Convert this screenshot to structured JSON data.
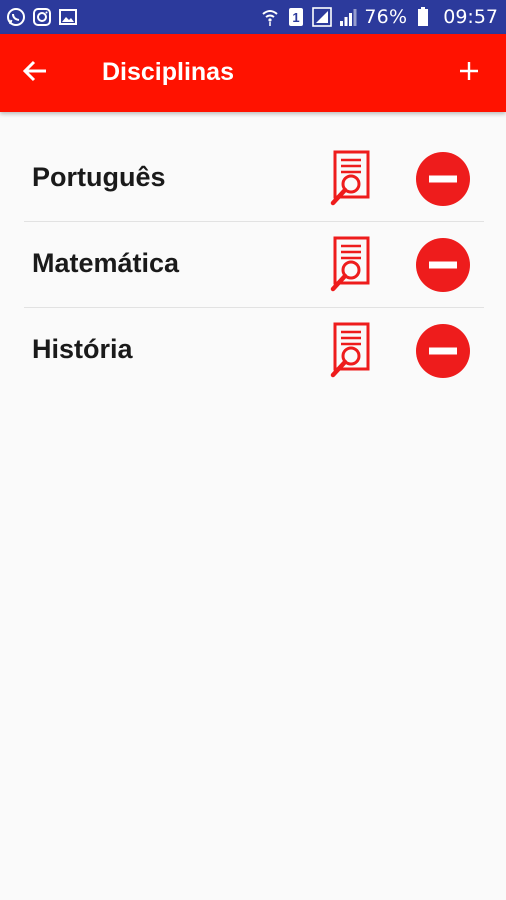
{
  "status_bar": {
    "battery_percent": "76%",
    "time": "09:57",
    "sim_slot": "1",
    "icons": [
      "whatsapp-icon",
      "instagram-icon",
      "gallery-icon",
      "wifi-icon",
      "sim-icon",
      "signal-icon",
      "battery-icon"
    ]
  },
  "app_bar": {
    "title": "Disciplinas",
    "back_icon": "arrow-back-icon",
    "add_icon": "plus-icon",
    "color": "#ff1200"
  },
  "subjects": [
    {
      "name": "Português"
    },
    {
      "name": "Matemática"
    },
    {
      "name": "História"
    }
  ],
  "colors": {
    "accent": "#ee1c1c",
    "status_bar": "#2c3a9c"
  }
}
